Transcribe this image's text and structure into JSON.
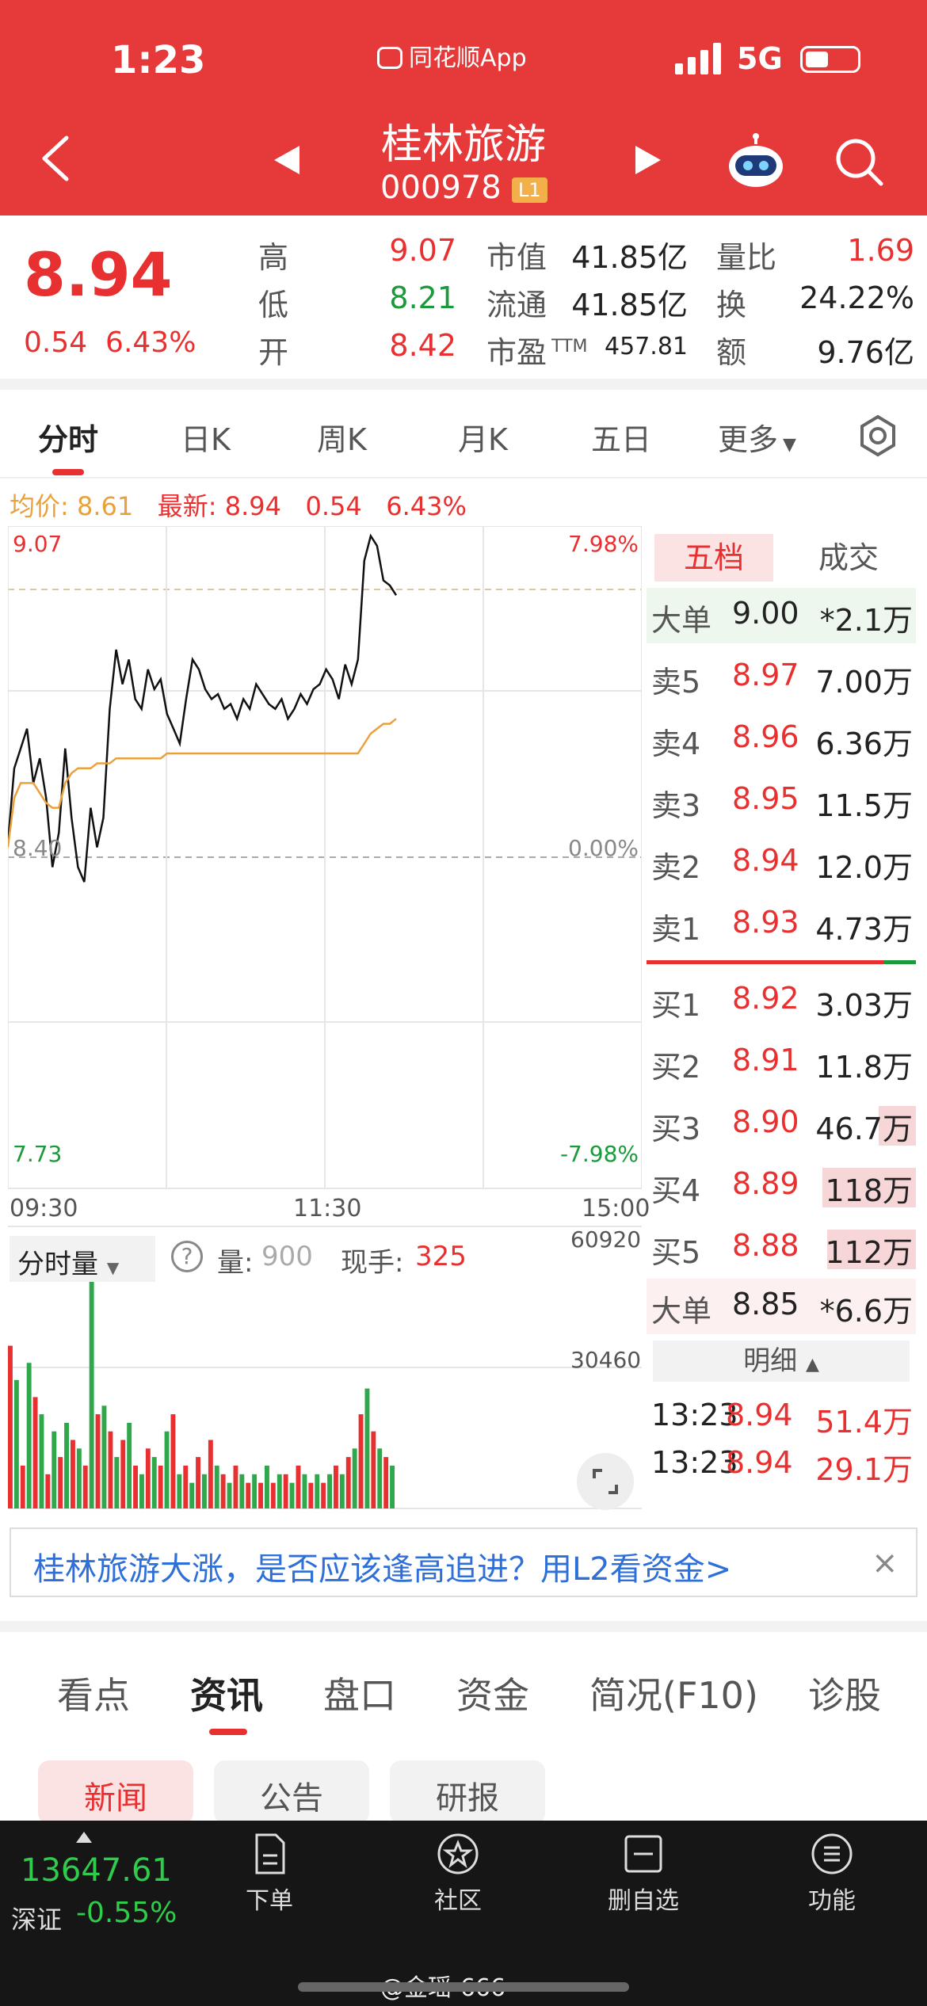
{
  "status": {
    "time": "1:23",
    "app": "同花顺App",
    "network": "5G"
  },
  "header": {
    "name": "桂林旅游",
    "code": "000978",
    "level": "L1"
  },
  "quote": {
    "price": "8.94",
    "change": "0.54",
    "change_pct": "6.43%",
    "high_label": "高",
    "high": "9.07",
    "low_label": "低",
    "low": "8.21",
    "open_label": "开",
    "open": "8.42",
    "mcap_label": "市值",
    "mcap": "41.85亿",
    "float_label": "流通",
    "float": "41.85亿",
    "pe_label": "市盈",
    "pe_sup": "TTM",
    "pe": "457.81",
    "volratio_label": "量比",
    "volratio": "1.69",
    "turnover_label": "换",
    "turnover": "24.22%",
    "amount_label": "额",
    "amount": "9.76亿"
  },
  "chart_tabs": [
    "分时",
    "日K",
    "周K",
    "月K",
    "五日",
    "更多"
  ],
  "avg_row": {
    "avg_label": "均价:",
    "avg": "8.61",
    "latest_label": "最新:",
    "latest": "8.94",
    "chg": "0.54",
    "pct": "6.43%"
  },
  "chart_data": {
    "type": "line",
    "y_top": "9.07",
    "y_mid": "8.40",
    "y_bottom": "7.73",
    "pct_top": "7.98%",
    "pct_mid": "0.00%",
    "pct_bottom": "-7.98%",
    "x_labels": [
      "09:30",
      "11:30",
      "15:00"
    ],
    "ylim": [
      7.73,
      9.07
    ],
    "series": [
      {
        "values": [
          8.43,
          8.58,
          8.62,
          8.66,
          8.55,
          8.6,
          8.52,
          8.38,
          8.45,
          8.62,
          8.48,
          8.38,
          8.35,
          8.5,
          8.42,
          8.48,
          8.7,
          8.82,
          8.75,
          8.8,
          8.72,
          8.7,
          8.78,
          8.74,
          8.76,
          8.69,
          8.66,
          8.63,
          8.72,
          8.8,
          8.78,
          8.74,
          8.72,
          8.73,
          8.7,
          8.71,
          8.68,
          8.72,
          8.7,
          8.75,
          8.73,
          8.71,
          8.7,
          8.72,
          8.68,
          8.7,
          8.73,
          8.71,
          8.74,
          8.75,
          8.78,
          8.76,
          8.72,
          8.79,
          8.75,
          8.8,
          9.0,
          9.05,
          9.03,
          8.96,
          8.95,
          8.93
        ]
      },
      {
        "values": [
          8.42,
          8.52,
          8.55,
          8.55,
          8.55,
          8.53,
          8.51,
          8.5,
          8.5,
          8.55,
          8.57,
          8.58,
          8.58,
          8.58,
          8.59,
          8.59,
          8.59,
          8.6,
          8.6,
          8.6,
          8.6,
          8.6,
          8.6,
          8.6,
          8.6,
          8.61,
          8.61,
          8.61,
          8.61,
          8.61,
          8.61,
          8.61,
          8.61,
          8.61,
          8.61,
          8.61,
          8.61,
          8.61,
          8.61,
          8.61,
          8.61,
          8.61,
          8.61,
          8.61,
          8.61,
          8.61,
          8.61,
          8.61,
          8.61,
          8.61,
          8.61,
          8.61,
          8.61,
          8.61,
          8.61,
          8.61,
          8.63,
          8.65,
          8.66,
          8.67,
          8.67,
          8.68
        ]
      }
    ],
    "volume": {
      "ymax": "60920",
      "ymid": "30460",
      "bars": [
        38,
        30,
        10,
        34,
        26,
        22,
        8,
        18,
        12,
        20,
        16,
        14,
        10,
        60,
        22,
        24,
        18,
        12,
        16,
        20,
        10,
        8,
        14,
        12,
        10,
        18,
        22,
        8,
        10,
        6,
        12,
        8,
        16,
        10,
        8,
        6,
        10,
        8,
        6,
        8,
        6,
        10,
        6,
        8,
        8,
        6,
        10,
        8,
        6,
        8,
        6,
        8,
        10,
        8,
        12,
        14,
        22,
        28,
        18,
        14,
        12,
        10
      ]
    }
  },
  "book": {
    "tab1": "五档",
    "tab2": "成交",
    "big_top": {
      "label": "大单",
      "price": "9.00",
      "vol": "*2.1万"
    },
    "asks": [
      {
        "label": "卖5",
        "price": "8.97",
        "vol": "7.00万"
      },
      {
        "label": "卖4",
        "price": "8.96",
        "vol": "6.36万"
      },
      {
        "label": "卖3",
        "price": "8.95",
        "vol": "11.5万"
      },
      {
        "label": "卖2",
        "price": "8.94",
        "vol": "12.0万"
      },
      {
        "label": "卖1",
        "price": "8.93",
        "vol": "4.73万"
      }
    ],
    "bids": [
      {
        "label": "买1",
        "price": "8.92",
        "vol": "3.03万"
      },
      {
        "label": "买2",
        "price": "8.91",
        "vol": "11.8万"
      },
      {
        "label": "买3",
        "price": "8.90",
        "vol": "46.7万"
      },
      {
        "label": "买4",
        "price": "8.89",
        "vol": "118万"
      },
      {
        "label": "买5",
        "price": "8.88",
        "vol": "112万"
      }
    ],
    "big_bottom": {
      "label": "大单",
      "price": "8.85",
      "vol": "*6.6万"
    },
    "detail_label": "明细",
    "trades": [
      {
        "time": "13:23",
        "price": "8.94",
        "vol": "51.4万"
      },
      {
        "time": "13:23",
        "price": "8.94",
        "vol": "29.1万"
      }
    ]
  },
  "volume_header": {
    "select": "分时量",
    "vol_label": "量:",
    "vol": "900",
    "hand_label": "现手:",
    "hand": "325"
  },
  "banner": {
    "text": "桂林旅游大涨，是否应该逢高追进？用L2看资金>",
    "close": "×"
  },
  "bottom_tabs": [
    "看点",
    "资讯",
    "盘口",
    "资金",
    "简况(F10)",
    "诊股"
  ],
  "sub_tabs": [
    "新闻",
    "公告",
    "研报"
  ],
  "nav": {
    "index_value": "13647.61",
    "index_name": "深证",
    "index_change": "-0.55%",
    "items": [
      "下单",
      "社区",
      "删自选",
      "功能"
    ],
    "watermark": "@金瑶-666"
  },
  "colors": {
    "accent": "#e5393a",
    "up": "#e93030",
    "down": "#1a9a3a",
    "avg": "#e9a23b"
  }
}
